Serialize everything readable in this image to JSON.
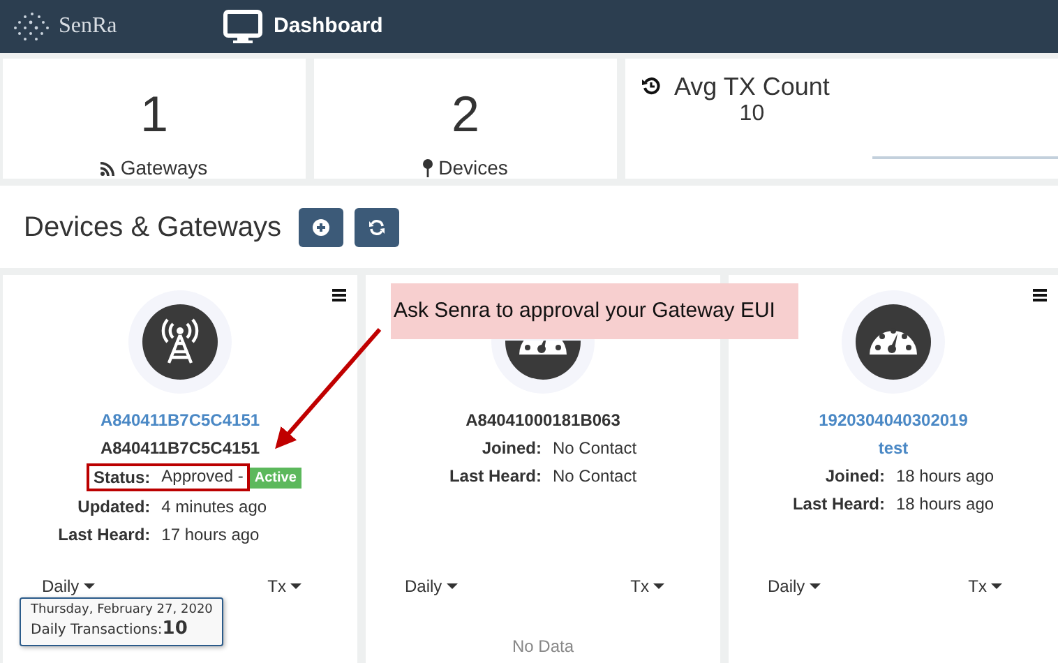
{
  "navbar": {
    "brand": "SenRa",
    "title": "Dashboard"
  },
  "stats": [
    {
      "kind": "gateways",
      "value": "1",
      "label": "Gateways"
    },
    {
      "kind": "devices",
      "value": "2",
      "label": "Devices"
    },
    {
      "kind": "average",
      "label": "Avg TX Count",
      "value": "10"
    }
  ],
  "section": {
    "title": "Devices & Gateways"
  },
  "cards": [
    {
      "kind": "gateway",
      "menu": true,
      "link": "A840411B7C5C4151",
      "name": "A840411B7C5C4151",
      "fields": [
        {
          "label": "Status:",
          "value": "Approved -",
          "badge": "Active"
        },
        {
          "label": "Updated:",
          "value": "4 minutes ago"
        },
        {
          "label": "Last Heard:",
          "value": "17 hours ago"
        }
      ],
      "period": "Daily",
      "metric": "Tx"
    },
    {
      "kind": "device",
      "menu": false,
      "name": "A84041000181B063",
      "fields": [
        {
          "label": "Joined:",
          "value": "No Contact"
        },
        {
          "label": "Last Heard:",
          "value": "No Contact"
        }
      ],
      "period": "Daily",
      "metric": "Tx",
      "empty_text": "No Data"
    },
    {
      "kind": "device",
      "menu": true,
      "link": "1920304040302019",
      "subtitle": "test",
      "fields": [
        {
          "label": "Joined:",
          "value": "18 hours ago"
        },
        {
          "label": "Last Heard:",
          "value": "18 hours ago"
        }
      ],
      "period": "Daily",
      "metric": "Tx"
    }
  ],
  "annotation": {
    "text": "Ask Senra to approval your Gateway EUI"
  },
  "tooltip": {
    "date": "Thursday, February 27, 2020",
    "label": "Daily Transactions:",
    "value": "10"
  }
}
